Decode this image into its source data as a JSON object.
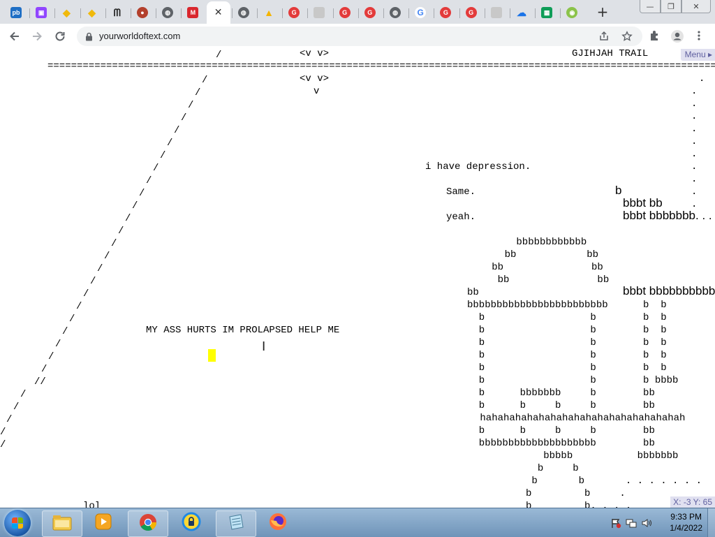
{
  "tabs": [
    {
      "icon": "pb-icon",
      "color": "#1f6fc5",
      "glyph": "pb"
    },
    {
      "icon": "twitch-icon",
      "color": "#9146ff",
      "glyph": "▣"
    },
    {
      "icon": "binance-icon",
      "color": "#f0b90b",
      "glyph": "◆"
    },
    {
      "icon": "binance-icon",
      "color": "#f0b90b",
      "glyph": "◆"
    },
    {
      "icon": "moon-icon",
      "color": "#222222",
      "glyph": "ᗰ"
    },
    {
      "icon": "boar-icon",
      "color": "#b3402c",
      "glyph": "●"
    },
    {
      "icon": "globe-icon",
      "color": "#5f6368",
      "glyph": "◍"
    },
    {
      "icon": "mega-icon",
      "color": "#d9272e",
      "glyph": "M"
    },
    {
      "icon": "close-icon",
      "active": true,
      "glyph": "✕"
    },
    {
      "icon": "globe-icon",
      "color": "#5f6368",
      "glyph": "◍"
    },
    {
      "icon": "drive-icon",
      "color": "#f4b400",
      "glyph": "▲"
    },
    {
      "icon": "grammarly-icon",
      "color": "#e33b3b",
      "glyph": "G"
    },
    {
      "icon": "blank-page-icon",
      "color": "#c8c8c8",
      "glyph": ""
    },
    {
      "icon": "grammarly-icon",
      "color": "#e33b3b",
      "glyph": "G"
    },
    {
      "icon": "grammarly-icon",
      "color": "#e33b3b",
      "glyph": "G"
    },
    {
      "icon": "globe-icon",
      "color": "#5f6368",
      "glyph": "◍"
    },
    {
      "icon": "google-icon",
      "color": "#4285f4",
      "glyph": "G"
    },
    {
      "icon": "grammarly-icon",
      "color": "#e33b3b",
      "glyph": "G"
    },
    {
      "icon": "grammarly-icon",
      "color": "#e33b3b",
      "glyph": "G"
    },
    {
      "icon": "blank-page-icon",
      "color": "#c8c8c8",
      "glyph": ""
    },
    {
      "icon": "cloud-upload-icon",
      "color": "#1a73e8",
      "glyph": "☁"
    },
    {
      "icon": "sheets-icon",
      "color": "#0f9d58",
      "glyph": "▦"
    },
    {
      "icon": "chrome-web-icon",
      "color": "#8bc34a",
      "glyph": "◉"
    }
  ],
  "toolbar": {
    "url": "yourworldoftext.com"
  },
  "page": {
    "menu_label": "Menu",
    "coords_label": "X: -3  Y: 65",
    "header_eye_1": "<v v>",
    "header_eye_2": "<v v>",
    "header_v": "v",
    "trail_title": "GJIHJAH TRAIL",
    "rule": "================================================================================================================================================================",
    "text_depression": "i have depression.",
    "text_same": "Same.",
    "text_yeah": "yeah.",
    "text_help": "MY ASS HURTS IM PROLAPSED HELP ME",
    "text_lol": "lol",
    "big_b1": "b",
    "big_b2": "bbbt bb",
    "big_b3": "bbbt bbbbbbb. . .",
    "big_b4": "bbbt bbbbbbbbbb",
    "house_lines": [
      "      bbbbbbbbbbbb",
      "    bb            bb",
      "   bb               bb",
      "    bb               bb",
      "bb",
      "bbbbbbbbbbbbbbbbbbbbbbbb      b  b",
      "  b                  b        b  b",
      "  b                  b        b  b",
      "  b                  b        b  b",
      "  b                  b        b  b",
      "  b                  b        b  b",
      "  b                  b        b bbbb",
      "  b      bbbbbbb     b        bb",
      "  b      b     b     b        bb",
      " hahahahahahahahahahahahahahahahahah",
      "  b      b     b     b        bb",
      "  bbbbbbbbbbbbbbbbbbbb        bb",
      "             bbbbb           bbbbbbb",
      "            b     b",
      "           b       b       . . . . . . .",
      "          b         b     .",
      "          b         b. . . ."
    ],
    "dots_column": [
      ".",
      ".",
      ".",
      ".",
      ".",
      ".",
      ".",
      ".",
      ".",
      ".",
      "."
    ]
  },
  "taskbar": {
    "apps": [
      {
        "icon": "file-explorer-icon"
      },
      {
        "icon": "media-player-icon"
      },
      {
        "icon": "chrome-icon"
      },
      {
        "icon": "vpn-lock-icon"
      },
      {
        "icon": "notepad-icon"
      },
      {
        "icon": "firefox-icon"
      }
    ],
    "time": "9:33 PM",
    "date": "1/4/2022"
  }
}
